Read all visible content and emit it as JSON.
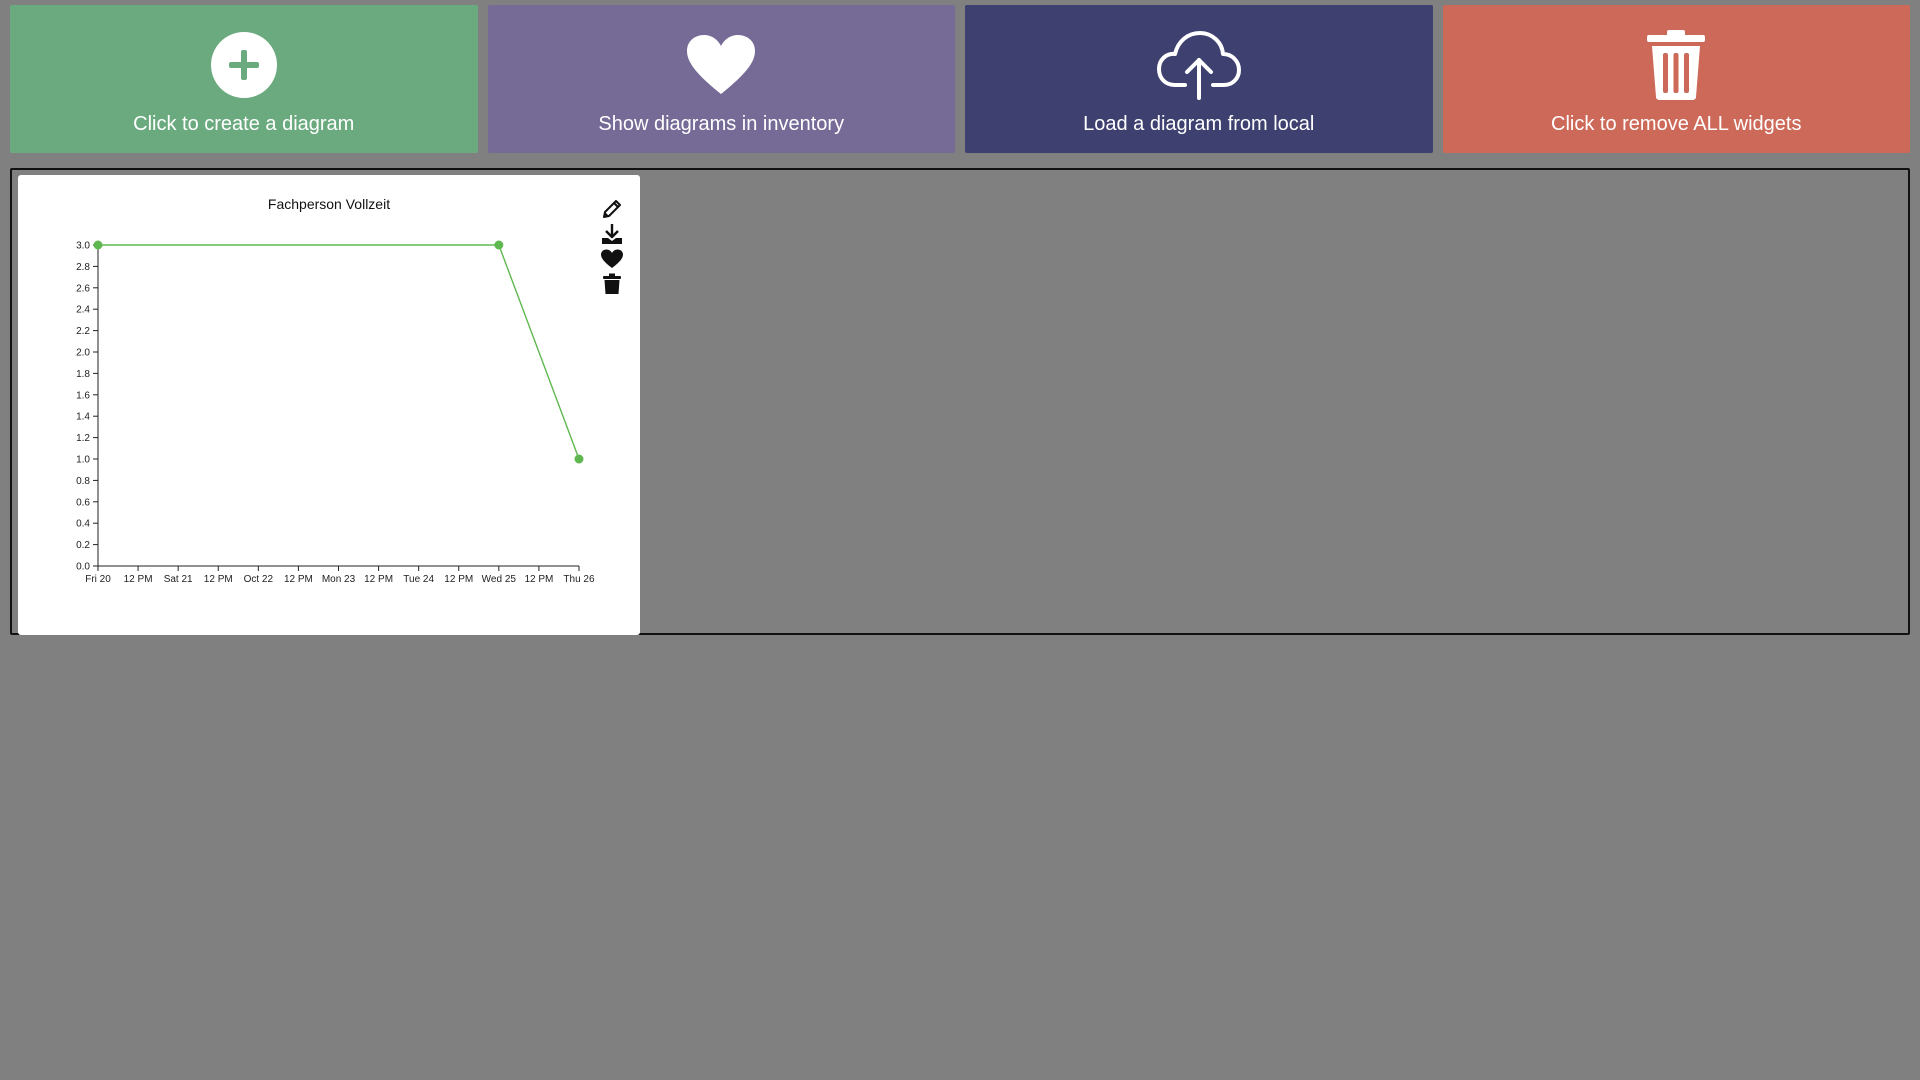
{
  "toolbar": {
    "create": {
      "label": "Click to create a diagram",
      "color": "#6aaa7e",
      "icon": "plus-circle-icon"
    },
    "inventory": {
      "label": "Show diagrams in inventory",
      "color": "#766a96",
      "icon": "heart-icon"
    },
    "load": {
      "label": "Load a diagram from local",
      "color": "#3e4170",
      "icon": "cloud-upload-icon"
    },
    "remove_all": {
      "label": "Click to remove ALL widgets",
      "color": "#cd6959",
      "icon": "trash-icon"
    }
  },
  "widget": {
    "tools": [
      "pencil-icon",
      "download-icon",
      "heart-icon",
      "trash-icon"
    ]
  },
  "chart_data": {
    "type": "line",
    "title": "Fachperson Vollzeit",
    "xlabel": "",
    "ylabel": "",
    "x_ticks": [
      "Fri 20",
      "12 PM",
      "Sat 21",
      "12 PM",
      "Oct 22",
      "12 PM",
      "Mon 23",
      "12 PM",
      "Tue 24",
      "12 PM",
      "Wed 25",
      "12 PM",
      "Thu 26"
    ],
    "y_ticks": [
      "0.0",
      "0.2",
      "0.4",
      "0.6",
      "0.8",
      "1.0",
      "1.2",
      "1.4",
      "1.6",
      "1.8",
      "2.0",
      "2.2",
      "2.4",
      "2.6",
      "2.8",
      "3.0"
    ],
    "ylim": [
      0,
      3
    ],
    "grid": false,
    "series": [
      {
        "color": "#5fb84f",
        "points": [
          {
            "x": "Oct 20",
            "y": 3
          },
          {
            "x": "Oct 25",
            "y": 3
          },
          {
            "x": "Oct 26",
            "y": 1
          }
        ]
      }
    ]
  }
}
